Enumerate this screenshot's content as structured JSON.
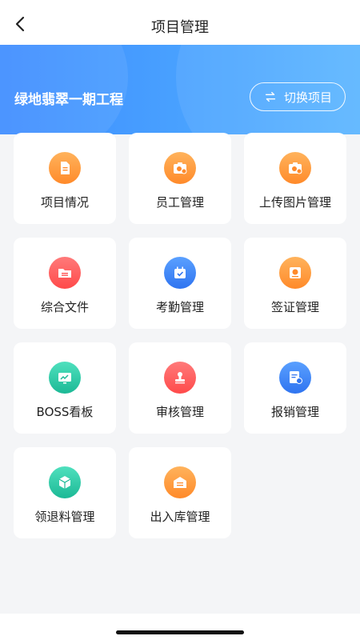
{
  "header": {
    "title": "项目管理"
  },
  "banner": {
    "project_name": "绿地翡翠一期工程",
    "switch_label": "切换项目"
  },
  "menu": [
    {
      "label": "项目情况",
      "icon": "document-icon",
      "color": "#ff9b3c"
    },
    {
      "label": "员工管理",
      "icon": "camera-icon",
      "color": "#ff9b3c"
    },
    {
      "label": "上传图片管理",
      "icon": "camera-icon",
      "color": "#ff9b3c"
    },
    {
      "label": "综合文件",
      "icon": "folder-icon",
      "color": "#ff5a5a"
    },
    {
      "label": "考勤管理",
      "icon": "calendar-check-icon",
      "color": "#3a86ff"
    },
    {
      "label": "签证管理",
      "icon": "seal-icon",
      "color": "#ff9b3c"
    },
    {
      "label": "BOSS看板",
      "icon": "dashboard-icon",
      "color": "#2ecba8"
    },
    {
      "label": "审核管理",
      "icon": "stamp-icon",
      "color": "#ff5a5a"
    },
    {
      "label": "报销管理",
      "icon": "invoice-icon",
      "color": "#3a86ff"
    },
    {
      "label": "领退料管理",
      "icon": "box-icon",
      "color": "#2ecba8"
    },
    {
      "label": "出入库管理",
      "icon": "warehouse-icon",
      "color": "#ff9b3c"
    }
  ]
}
